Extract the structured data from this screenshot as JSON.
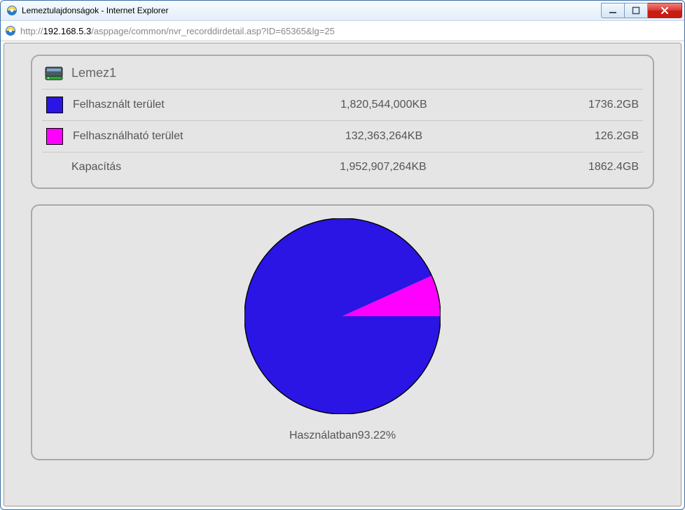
{
  "window": {
    "title": "Lemeztulajdonságok - Internet Explorer",
    "url_prefix": "http://",
    "url_host": "192.168.5.3",
    "url_path": "/asppage/common/nvr_recorddirdetail.asp?ID=65365&lg=25"
  },
  "buttons": {
    "minimize_icon": "min-icon",
    "maximize_icon": "max-icon",
    "close_icon": "close-icon"
  },
  "disk": {
    "name": "Lemez1",
    "rows": [
      {
        "key": "used",
        "label": "Felhasznált terület",
        "kb": "1,820,544,000KB",
        "gb": "1736.2GB",
        "swatch": "used"
      },
      {
        "key": "free",
        "label": "Felhasználható terület",
        "kb": "132,363,264KB",
        "gb": "126.2GB",
        "swatch": "free"
      },
      {
        "key": "capacity",
        "label": "Kapacítás",
        "kb": "1,952,907,264KB",
        "gb": "1862.4GB",
        "swatch": "none"
      }
    ]
  },
  "usage": {
    "caption_prefix": "Használatban",
    "percent_text": "93.22%"
  },
  "colors": {
    "used": "#2a15e4",
    "free": "#ff00ff",
    "outline": "#000000"
  },
  "chart_data": {
    "type": "pie",
    "title": "Használatban93.22%",
    "series": [
      {
        "name": "Felhasznált terület",
        "value": 93.22,
        "color": "#2a15e4"
      },
      {
        "name": "Felhasználható terület",
        "value": 6.78,
        "color": "#ff00ff"
      }
    ]
  }
}
